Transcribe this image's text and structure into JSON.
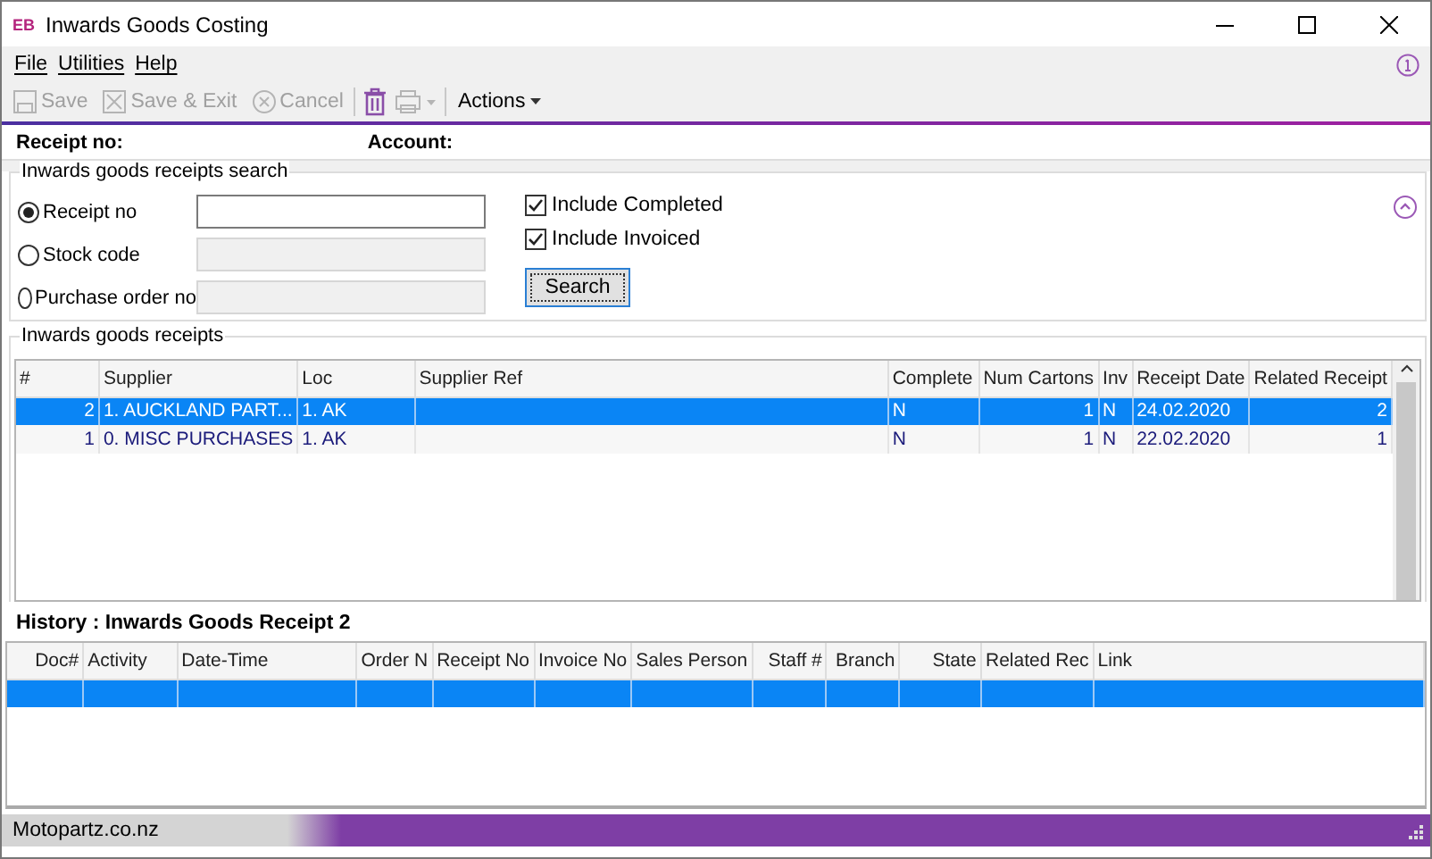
{
  "window": {
    "logo": "EB",
    "title": "Inwards Goods Costing"
  },
  "menu": [
    "File",
    "Utilities",
    "Help"
  ],
  "toolbar": [
    {
      "kind": "save",
      "label": "Save",
      "disabled": true
    },
    {
      "kind": "save_exit",
      "label": "Save & Exit",
      "disabled": true
    },
    {
      "kind": "cancel",
      "label": "Cancel",
      "disabled": true
    },
    {
      "kind": "delete",
      "disabled": false
    },
    {
      "kind": "print",
      "disabled": true
    },
    {
      "kind": "actions",
      "label": "Actions",
      "disabled": false
    }
  ],
  "header": {
    "receipt_label": "Receipt no:",
    "account_label": "Account:"
  },
  "search": {
    "title": "Inwards goods receipts search",
    "options": [
      {
        "label": "Receipt no",
        "selected": true,
        "disabled": false
      },
      {
        "label": "Stock code",
        "selected": false,
        "disabled": true
      },
      {
        "label": "Purchase order no",
        "selected": false,
        "disabled": true
      }
    ],
    "checks": [
      {
        "label": "Include Completed",
        "checked": true
      },
      {
        "label": "Include Invoiced",
        "checked": true
      }
    ],
    "button": "Search",
    "expanded": true
  },
  "receipts": {
    "title": "Inwards goods receipts",
    "columns": [
      "#",
      "Supplier",
      "Loc",
      "Supplier Ref",
      "Complete",
      "Num Cartons",
      "Inv",
      "Receipt Date",
      "Related Receipt"
    ],
    "rows": [
      {
        "selected": true,
        "cells": [
          "2",
          "1. AUCKLAND PART...",
          "1. AK",
          "",
          "N",
          "1",
          "N",
          "24.02.2020",
          "2"
        ]
      },
      {
        "selected": false,
        "cells": [
          "1",
          "0. MISC PURCHASES",
          "1. AK",
          "",
          "N",
          "1",
          "N",
          "22.02.2020",
          "1"
        ]
      }
    ]
  },
  "history": {
    "title": "History : Inwards Goods Receipt 2",
    "columns": [
      "Doc#",
      "Activity",
      "Date-Time",
      "Order N",
      "Receipt No",
      "Invoice No",
      "Sales Person",
      "Staff #",
      "Branch",
      "State",
      "Related Rec",
      "Link"
    ],
    "rows": [
      {
        "selected": true
      }
    ]
  },
  "status_bar": {
    "text": "Motopartz.co.nz"
  }
}
